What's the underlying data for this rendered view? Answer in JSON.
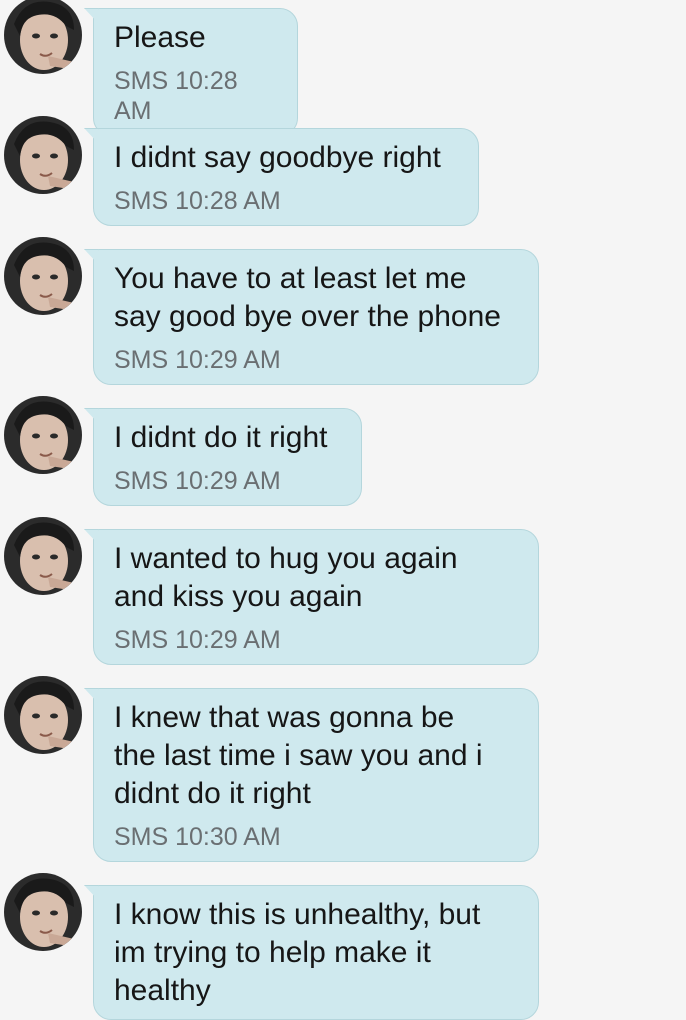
{
  "conversation": {
    "messages": [
      {
        "text": "Please",
        "meta": "SMS 10:28 AM"
      },
      {
        "text": "I didnt say goodbye right",
        "meta": "SMS 10:28 AM"
      },
      {
        "text": "You have to at least let me\nsay good bye over the phone",
        "meta": "SMS 10:29 AM"
      },
      {
        "text": "I didnt do it right",
        "meta": "SMS 10:29 AM"
      },
      {
        "text": "I wanted to hug you again\nand kiss you again",
        "meta": "SMS 10:29 AM"
      },
      {
        "text": "I knew that was gonna be\nthe last time i saw you and i\ndidnt do it right",
        "meta": "SMS 10:30 AM"
      },
      {
        "text": "I know this is unhealthy, but\nim trying to help make it\nhealthy",
        "meta": ""
      }
    ]
  },
  "colors": {
    "background": "#f5f5f5",
    "bubble": "#cfe9ee",
    "bubble_border": "#b4d6dc",
    "text": "#161616",
    "meta": "#6a6f72"
  },
  "icons": {
    "avatar": "contact-avatar-photo"
  }
}
